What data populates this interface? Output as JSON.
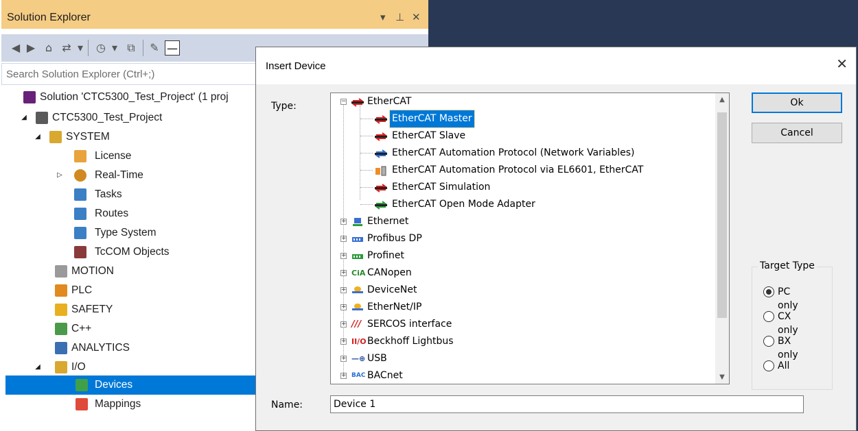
{
  "solution_explorer": {
    "title": "Solution Explorer",
    "title_controls": [
      "▾",
      "⊥",
      "✕"
    ],
    "search_placeholder": "Search Solution Explorer (Ctrl+;)",
    "toolbar_icons": [
      "back-icon",
      "forward-icon",
      "home-icon",
      "sync-icon",
      "history-icon",
      "collapse-icon",
      "properties-icon",
      "preview-icon"
    ],
    "tree": [
      {
        "label": "Solution 'CTC5300_Test_Project' (1 proj",
        "icon": "solution-icon",
        "color": "#68217a"
      },
      {
        "label": "CTC5300_Test_Project",
        "icon": "project-icon",
        "color": "#5a5a5a"
      },
      {
        "label": "SYSTEM",
        "icon": "system-icon",
        "color": "#d9a830"
      },
      {
        "label": "License",
        "icon": "license-icon",
        "color": "#e8a33c"
      },
      {
        "label": "Real-Time",
        "icon": "realtime-icon",
        "color": "#d08a20"
      },
      {
        "label": "Tasks",
        "icon": "tasks-icon",
        "color": "#3b7fc4"
      },
      {
        "label": "Routes",
        "icon": "routes-icon",
        "color": "#3b7fc4"
      },
      {
        "label": "Type System",
        "icon": "type-system-icon",
        "color": "#3b7fc4"
      },
      {
        "label": "TcCOM Objects",
        "icon": "tccom-icon",
        "color": "#8a3a3a"
      },
      {
        "label": "MOTION",
        "icon": "motion-icon",
        "color": "#9a9a9a"
      },
      {
        "label": "PLC",
        "icon": "plc-icon",
        "color": "#e08a20"
      },
      {
        "label": "SAFETY",
        "icon": "safety-icon",
        "color": "#e8b020"
      },
      {
        "label": "C++",
        "icon": "cpp-icon",
        "color": "#4a9a4a"
      },
      {
        "label": "ANALYTICS",
        "icon": "analytics-icon",
        "color": "#3b6fb4"
      },
      {
        "label": "I/O",
        "icon": "io-icon",
        "color": "#d9a830"
      },
      {
        "label": "Devices",
        "icon": "devices-icon",
        "color": "#3fa04a"
      },
      {
        "label": "Mappings",
        "icon": "mappings-icon",
        "color": "#e04a3a"
      }
    ]
  },
  "dialog": {
    "title": "Insert Device",
    "close": "✕",
    "type_label": "Type:",
    "name_label": "Name:",
    "name_value": "Device 1",
    "ok_label": "Ok",
    "cancel_label": "Cancel",
    "target_type": {
      "legend": "Target Type",
      "options": [
        "PC only",
        "CX only",
        "BX only",
        "All"
      ],
      "selected": "PC only"
    },
    "type_tree": [
      {
        "label": "EtherCAT",
        "icon": "ethercat-icon",
        "expanded": true
      },
      {
        "label": "EtherCAT Master",
        "icon": "ethercat-master-icon",
        "selected": true
      },
      {
        "label": "EtherCAT Slave",
        "icon": "ethercat-slave-icon"
      },
      {
        "label": "EtherCAT Automation Protocol (Network Variables)",
        "icon": "eap-icon"
      },
      {
        "label": "EtherCAT Automation Protocol via EL6601, EtherCAT",
        "icon": "el6601-icon"
      },
      {
        "label": "EtherCAT Simulation",
        "icon": "ethercat-sim-icon"
      },
      {
        "label": "EtherCAT Open Mode Adapter",
        "icon": "open-mode-icon"
      },
      {
        "label": "Ethernet",
        "icon": "ethernet-icon"
      },
      {
        "label": "Profibus DP",
        "icon": "profibus-icon"
      },
      {
        "label": "Profinet",
        "icon": "profinet-icon"
      },
      {
        "label": "CANopen",
        "icon": "canopen-icon"
      },
      {
        "label": "DeviceNet",
        "icon": "devicenet-icon"
      },
      {
        "label": "EtherNet/IP",
        "icon": "ethernetip-icon"
      },
      {
        "label": "SERCOS interface",
        "icon": "sercos-icon"
      },
      {
        "label": "Beckhoff Lightbus",
        "icon": "lightbus-icon"
      },
      {
        "label": "USB",
        "icon": "usb-icon"
      },
      {
        "label": "BACnet",
        "icon": "bacnet-icon"
      }
    ],
    "icon_text": {
      "canopen": "CiA",
      "lightbus": "II/O",
      "bacnet": "BAC",
      "sercos": "///",
      "usb": "—⊕"
    }
  }
}
